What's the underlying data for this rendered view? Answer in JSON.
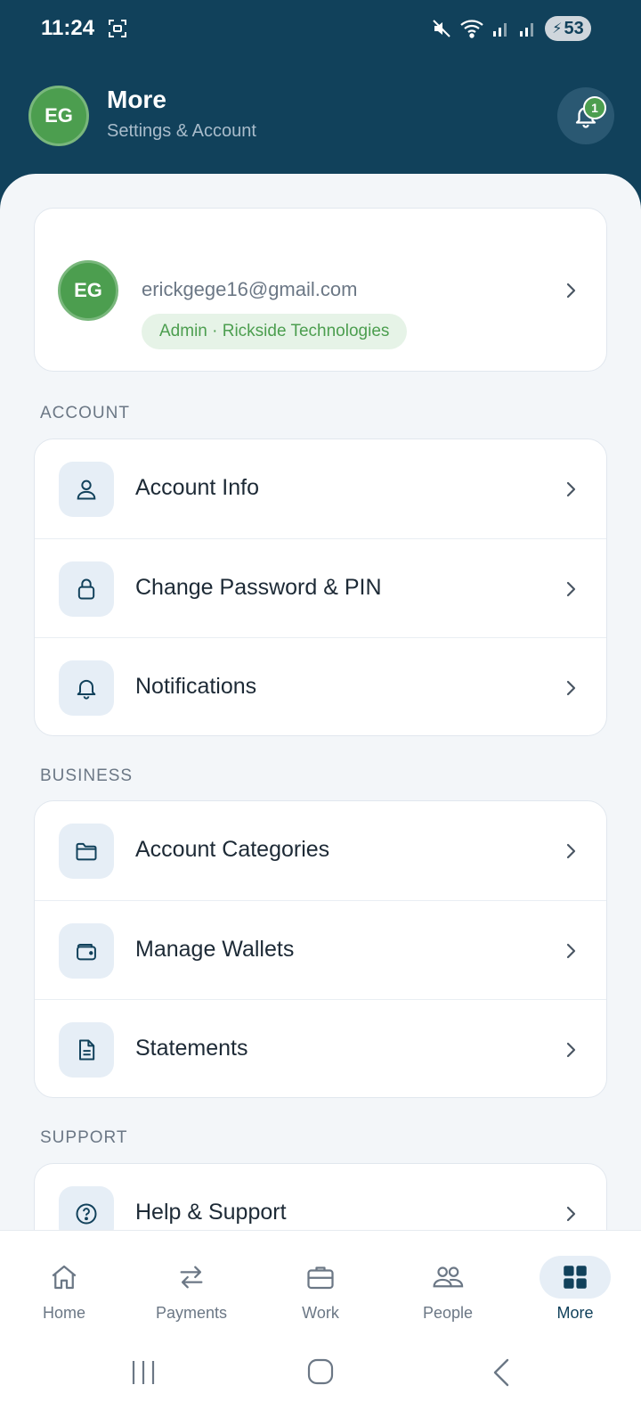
{
  "status_bar": {
    "time": "11:24",
    "battery": "53"
  },
  "header": {
    "avatar_initials": "EG",
    "title": "More",
    "subtitle": "Settings & Account",
    "notification_count": "1"
  },
  "profile": {
    "initials": "EG",
    "email": "erickgege16@gmail.com",
    "role": "Admin · Rickside Technologies"
  },
  "sections": {
    "account": {
      "label": "ACCOUNT",
      "items": [
        {
          "label": "Account Info",
          "icon": "user-icon"
        },
        {
          "label": "Change Password & PIN",
          "icon": "lock-icon"
        },
        {
          "label": "Notifications",
          "icon": "bell-icon"
        }
      ]
    },
    "business": {
      "label": "BUSINESS",
      "items": [
        {
          "label": "Account Categories",
          "icon": "folder-icon"
        },
        {
          "label": "Manage Wallets",
          "icon": "wallet-icon"
        },
        {
          "label": "Statements",
          "icon": "document-icon"
        }
      ]
    },
    "support": {
      "label": "SUPPORT",
      "items": [
        {
          "label": "Help & Support",
          "icon": "help-icon"
        }
      ]
    }
  },
  "bottom_nav": [
    {
      "label": "Home",
      "icon": "home-icon"
    },
    {
      "label": "Payments",
      "icon": "transfer-icon"
    },
    {
      "label": "Work",
      "icon": "briefcase-icon"
    },
    {
      "label": "People",
      "icon": "people-icon"
    },
    {
      "label": "More",
      "icon": "grid-icon",
      "active": true
    }
  ],
  "colors": {
    "header": "#11415b",
    "accent_green": "#4c9e4f",
    "background": "#f3f6f9",
    "text_primary": "#1d2a36"
  }
}
